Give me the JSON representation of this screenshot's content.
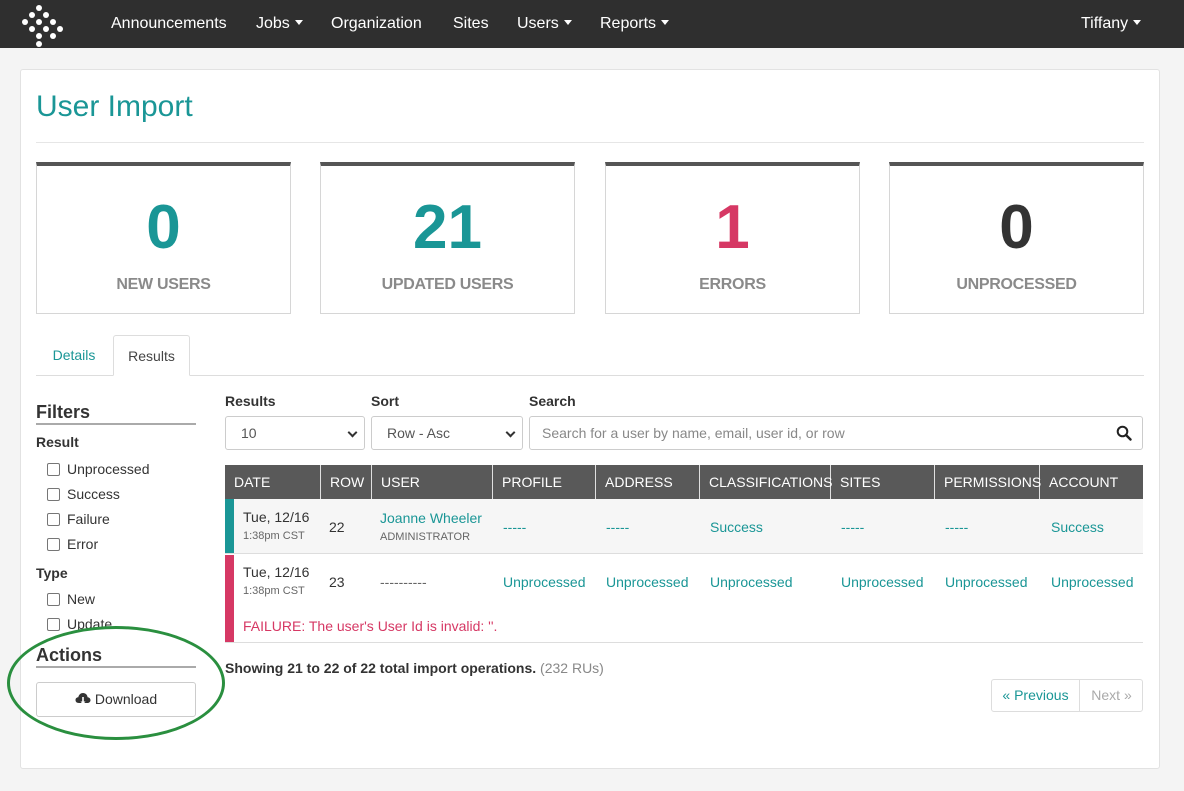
{
  "nav": {
    "items": [
      {
        "label": "Announcements",
        "dropdown": false
      },
      {
        "label": "Jobs",
        "dropdown": true
      },
      {
        "label": "Organization",
        "dropdown": false
      },
      {
        "label": "Sites",
        "dropdown": false
      },
      {
        "label": "Users",
        "dropdown": true
      },
      {
        "label": "Reports",
        "dropdown": true
      }
    ],
    "user": "Tiffany"
  },
  "page": {
    "title": "User Import"
  },
  "stats": [
    {
      "value": "0",
      "label": "NEW USERS",
      "color": "#1a9696"
    },
    {
      "value": "21",
      "label": "UPDATED USERS",
      "color": "#1a9696"
    },
    {
      "value": "1",
      "label": "ERRORS",
      "color": "#d63864"
    },
    {
      "value": "0",
      "label": "UNPROCESSED",
      "color": "#333333"
    }
  ],
  "tabs": [
    {
      "label": "Details",
      "active": false
    },
    {
      "label": "Results",
      "active": true
    }
  ],
  "filters": {
    "heading": "Filters",
    "result_label": "Result",
    "result_options": [
      "Unprocessed",
      "Success",
      "Failure",
      "Error"
    ],
    "type_label": "Type",
    "type_options": [
      "New",
      "Update"
    ]
  },
  "actions": {
    "heading": "Actions",
    "download_label": "Download"
  },
  "controls": {
    "results_label": "Results",
    "results_value": "10",
    "sort_label": "Sort",
    "sort_value": "Row - Asc",
    "search_label": "Search",
    "search_placeholder": "Search for a user by name, email, user id, or row"
  },
  "table": {
    "columns": [
      "DATE",
      "ROW",
      "USER",
      "PROFILE",
      "ADDRESS",
      "CLASSIFICATIONS",
      "SITES",
      "PERMISSIONS",
      "ACCOUNT"
    ],
    "rows": [
      {
        "status_color": "#1a9696",
        "date": "Tue, 12/16",
        "time": "1:38pm CST",
        "row": "22",
        "user": "Joanne Wheeler",
        "user_role": "ADMINISTRATOR",
        "profile": "-----",
        "address": "-----",
        "classifications": "Success",
        "sites": "-----",
        "permissions": "-----",
        "account": "Success"
      },
      {
        "status_color": "#d63864",
        "date": "Tue, 12/16",
        "time": "1:38pm CST",
        "row": "23",
        "user": "----------",
        "profile": "Unprocessed",
        "address": "Unprocessed",
        "classifications": "Unprocessed",
        "sites": "Unprocessed",
        "permissions": "Unprocessed",
        "account": "Unprocessed",
        "message": "FAILURE: The user's User Id is invalid: ''."
      }
    ]
  },
  "summary": {
    "showing": "Showing 21 to 22 of 22 total import operations.",
    "ru": "(232 RUs)"
  },
  "pagination": {
    "prev": "« Previous",
    "next": "Next »"
  }
}
